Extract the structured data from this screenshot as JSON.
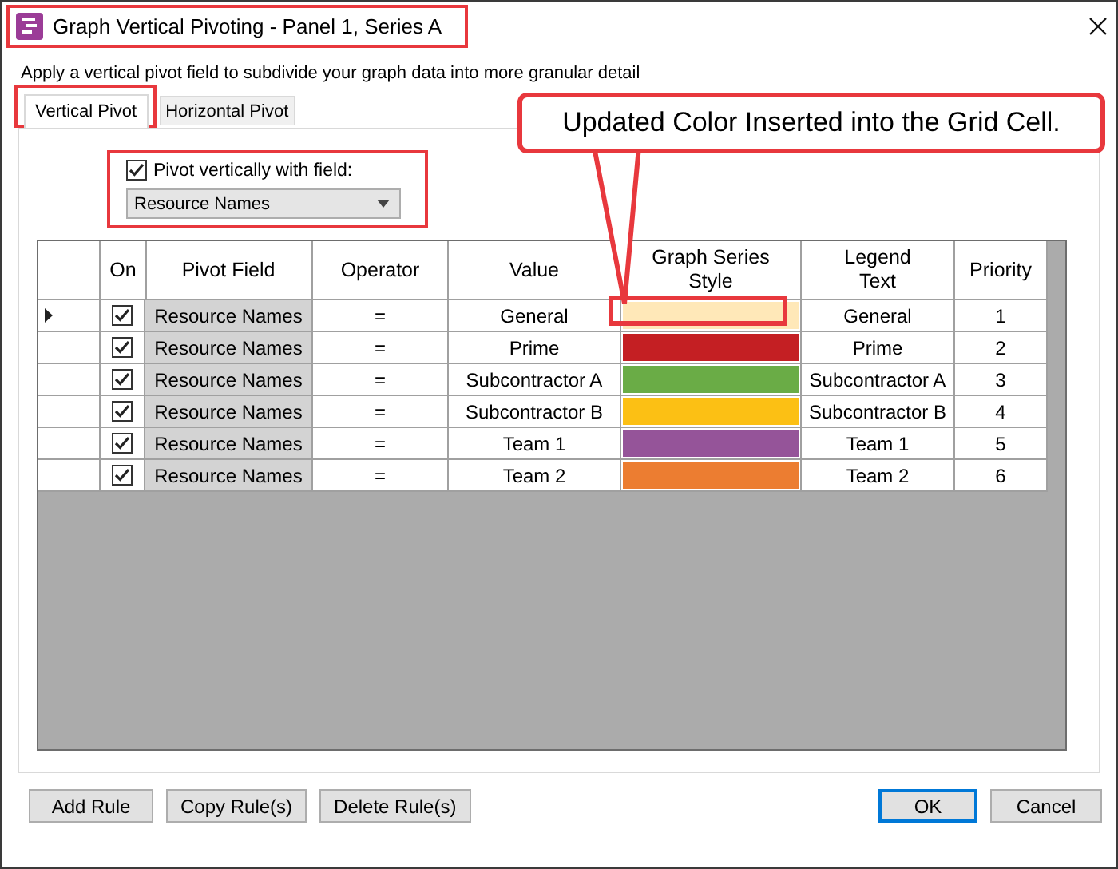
{
  "window": {
    "title": "Graph Vertical Pivoting - Panel 1, Series A",
    "title_highlighted": true
  },
  "description": "Apply a vertical pivot field to subdivide your graph data into more granular detail",
  "tabs": [
    {
      "label": "Vertical Pivot",
      "selected": true,
      "highlighted": true
    },
    {
      "label": "Horizontal Pivot",
      "selected": false,
      "highlighted": false
    }
  ],
  "pivot_group": {
    "highlighted": true,
    "checkbox": {
      "label": "Pivot vertically with field:",
      "checked": true
    },
    "dropdown": {
      "value": "Resource Names"
    }
  },
  "table": {
    "columns": [
      "On",
      "Pivot Field",
      "Operator",
      "Value",
      "Graph Series Style",
      "Legend Text",
      "Priority"
    ],
    "rows": [
      {
        "current": true,
        "on": true,
        "pivot_field": "Resource Names",
        "operator": "=",
        "value": "General",
        "color": "#ffe8b8",
        "highlighted": true,
        "legend": "General",
        "priority": "1"
      },
      {
        "current": false,
        "on": true,
        "pivot_field": "Resource Names",
        "operator": "=",
        "value": "Prime",
        "color": "#c41f23",
        "highlighted": false,
        "legend": "Prime",
        "priority": "2"
      },
      {
        "current": false,
        "on": true,
        "pivot_field": "Resource Names",
        "operator": "=",
        "value": "Subcontractor A",
        "color": "#6aac46",
        "highlighted": false,
        "legend": "Subcontractor A",
        "priority": "3"
      },
      {
        "current": false,
        "on": true,
        "pivot_field": "Resource Names",
        "operator": "=",
        "value": "Subcontractor B",
        "color": "#fcc014",
        "highlighted": false,
        "legend": "Subcontractor B",
        "priority": "4"
      },
      {
        "current": false,
        "on": true,
        "pivot_field": "Resource Names",
        "operator": "=",
        "value": "Team 1",
        "color": "#955499",
        "highlighted": false,
        "legend": "Team 1",
        "priority": "5"
      },
      {
        "current": false,
        "on": true,
        "pivot_field": "Resource Names",
        "operator": "=",
        "value": "Team 2",
        "color": "#ec7d31",
        "highlighted": false,
        "legend": "Team 2",
        "priority": "6"
      }
    ]
  },
  "callout": {
    "text": "Updated Color Inserted into the Grid Cell."
  },
  "left_buttons": [
    "Add Rule",
    "Copy Rule(s)",
    "Delete Rule(s)"
  ],
  "right_buttons": [
    {
      "label": "OK",
      "default": true
    },
    {
      "label": "Cancel",
      "default": false
    }
  ]
}
